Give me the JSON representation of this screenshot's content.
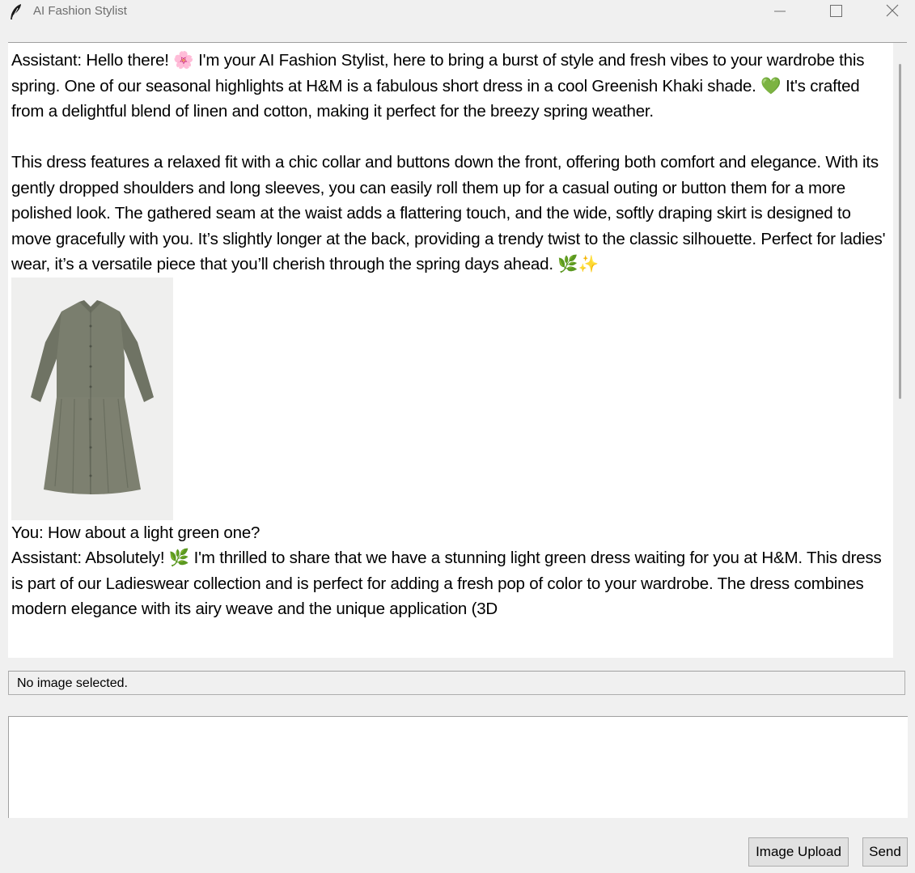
{
  "window": {
    "title": "AI Fashion Stylist",
    "icons": [
      "feather-icon",
      "minimize-icon",
      "maximize-icon",
      "close-icon"
    ]
  },
  "chat": {
    "paragraphs": [
      "Assistant: Hello there! 🌸 I'm your AI Fashion Stylist, here to bring a burst of style and fresh vibes to your wardrobe this spring. One of our seasonal highlights at H&M is a fabulous short dress in a cool Greenish Khaki shade. 💚 It's crafted from a delightful blend of linen and cotton, making it perfect for the breezy spring weather.",
      "This dress features a relaxed fit with a chic collar and buttons down the front, offering both comfort and elegance. With its gently dropped shoulders and long sleeves, you can easily roll them up for a casual outing or button them for a more polished look. The gathered seam at the waist adds a flattering touch, and the wide, softly draping skirt is designed to move gracefully with you. It’s slightly longer at the back, providing a trendy twist to the classic silhouette. Perfect for ladies' wear, it’s a versatile piece that you’ll cherish through the spring days ahead. 🌿✨",
      "You: How about a light green one?",
      "Assistant: Absolutely! 🌿 I'm thrilled to share that we have a stunning light green dress waiting for you at H&M. This dress is part of our Ladieswear collection and is perfect for adding a fresh pop of color to your wardrobe. The dress combines modern elegance with its airy weave and the unique application (3D"
    ],
    "product_image": "greenish-khaki-shirt-dress"
  },
  "status": {
    "text": "No image selected."
  },
  "input": {
    "value": ""
  },
  "buttons": {
    "upload": "Image Upload",
    "send": "Send"
  },
  "colors": {
    "window_bg": "#f0f0f0",
    "text_area_bg": "#ffffff",
    "button_bg": "#e1e1e1",
    "dress": "#7d8070"
  }
}
